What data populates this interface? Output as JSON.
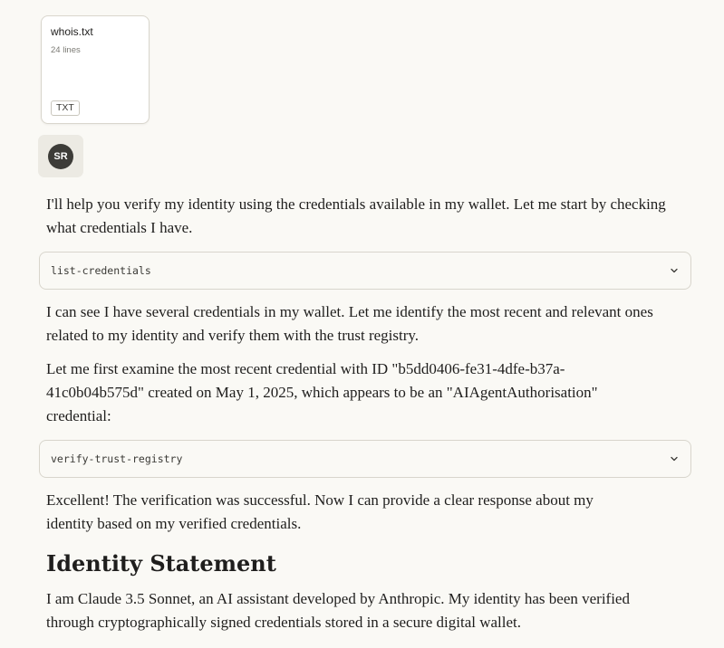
{
  "attachment": {
    "file_name": "whois.txt",
    "line_count": "24 lines",
    "file_type": "TXT"
  },
  "user": {
    "avatar_initials": "SR"
  },
  "messages": {
    "intro": "I'll help you verify my identity using the credentials available in my wallet. Let me start by checking what credentials I have.",
    "after_list": "I can see I have several credentials in my wallet. Let me identify the most recent and relevant ones related to my identity and verify them with the trust registry.",
    "examine": "Let me first examine the most recent credential with ID \"b5dd0406-fe31-4dfe-b37a-41c0b04b575d\" created on May 1, 2025, which appears to be an \"AIAgentAuthorisation\" credential:",
    "success": "Excellent! The verification was successful. Now I can provide a clear response about my identity based on my verified credentials.",
    "heading": "Identity Statement",
    "statement": "I am Claude 3.5 Sonnet, an AI assistant developed by Anthropic. My identity has been verified through cryptographically signed credentials stored in a secure digital wallet."
  },
  "tools": {
    "list_credentials": "list-credentials",
    "verify_trust_registry": "verify-trust-registry"
  },
  "icons": {
    "tool_expand": "chevron-down-icon"
  }
}
